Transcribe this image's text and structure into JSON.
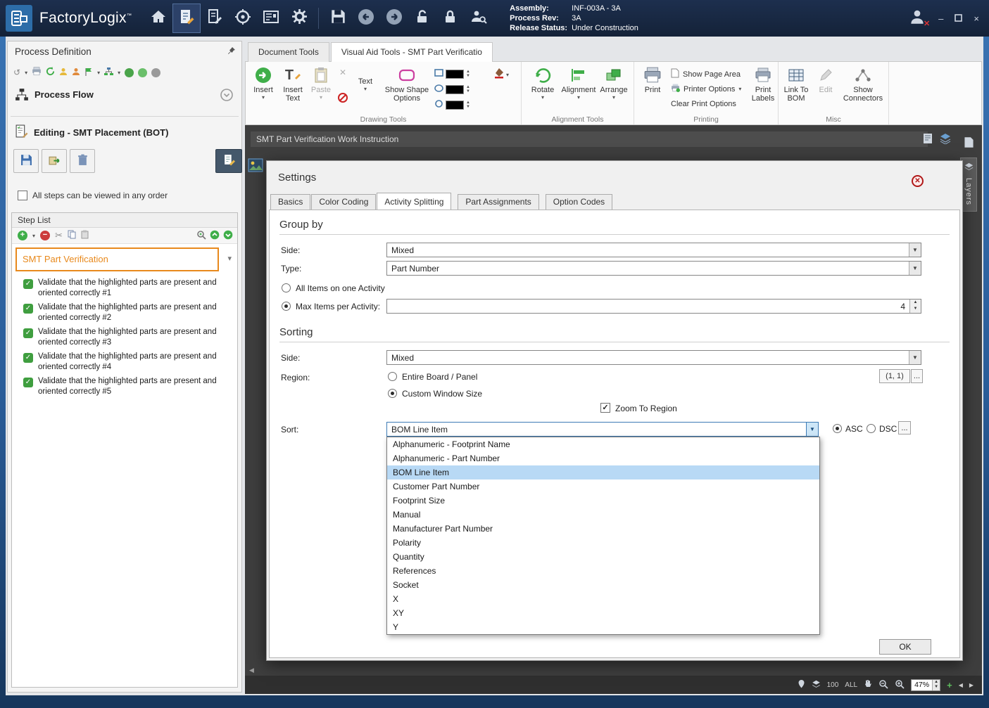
{
  "titlebar": {
    "app_name": "FactoryLogix",
    "assembly_label": "Assembly:",
    "assembly_value": "INF-003A - 3A",
    "process_rev_label": "Process Rev:",
    "process_rev_value": "3A",
    "release_status_label": "Release Status:",
    "release_status_value": "Under Construction"
  },
  "left_panel": {
    "title": "Process Definition",
    "process_flow": "Process Flow",
    "editing_title": "Editing - SMT Placement (BOT)",
    "order_checkbox": "All steps can be viewed in any order",
    "step_list_title": "Step List",
    "selected_step": "SMT Part Verification",
    "steps": [
      "Validate that the highlighted parts are present and oriented correctly #1",
      "Validate that the highlighted parts are present and oriented correctly #2",
      "Validate that the highlighted parts are present and oriented correctly #3",
      "Validate that the highlighted parts are present and oriented correctly #4",
      "Validate that the highlighted parts are present and oriented correctly #5"
    ]
  },
  "ribbon": {
    "tabs": [
      "Document Tools",
      "Visual Aid Tools - SMT Part Verificatio"
    ],
    "insert": "Insert",
    "insert_text": "Insert Text",
    "paste": "Paste",
    "text": "Text",
    "show_shape_options": "Show Shape Options",
    "drawing_group": "Drawing Tools",
    "rotate": "Rotate",
    "alignment": "Alignment",
    "arrange": "Arrange",
    "alignment_group": "Alignment Tools",
    "print": "Print",
    "show_page_area": "Show Page Area",
    "printer_options": "Printer Options",
    "clear_print_options": "Clear Print Options",
    "print_labels": "Print Labels",
    "printing_group": "Printing",
    "link_to_bom": "Link To BOM",
    "edit": "Edit",
    "show_connectors": "Show Connectors",
    "misc_group": "Misc"
  },
  "document": {
    "title": "SMT Part Verification Work Instruction",
    "layers_tab": "Layers"
  },
  "statusbar": {
    "value_100": "100",
    "value_all": "ALL",
    "zoom": "47%"
  },
  "dialog": {
    "title": "Settings",
    "tabs": [
      "Basics",
      "Color Coding",
      "Activity Splitting",
      "Part Assignments",
      "Option Codes"
    ],
    "group_by": {
      "heading": "Group by",
      "side_label": "Side:",
      "side_value": "Mixed",
      "type_label": "Type:",
      "type_value": "Part Number",
      "all_items_radio": "All Items on one Activity",
      "max_items_radio": "Max Items per Activity:",
      "max_items_value": "4"
    },
    "sorting": {
      "heading": "Sorting",
      "side_label": "Side:",
      "side_value": "Mixed",
      "region_label": "Region:",
      "entire_board_radio": "Entire Board / Panel",
      "custom_window_radio": "Custom Window Size",
      "region_value": "(1, 1)",
      "zoom_to_region": "Zoom To Region",
      "sort_label": "Sort:",
      "sort_value": "BOM Line Item",
      "asc": "ASC",
      "dsc": "DSC",
      "more": "...",
      "options": [
        "Alphanumeric - Footprint Name",
        "Alphanumeric - Part Number",
        "BOM Line Item",
        "Customer Part Number",
        "Footprint Size",
        "Manual",
        "Manufacturer Part Number",
        "Polarity",
        "Quantity",
        "References",
        "Socket",
        "X",
        "XY",
        "Y"
      ]
    },
    "ok": "OK"
  }
}
